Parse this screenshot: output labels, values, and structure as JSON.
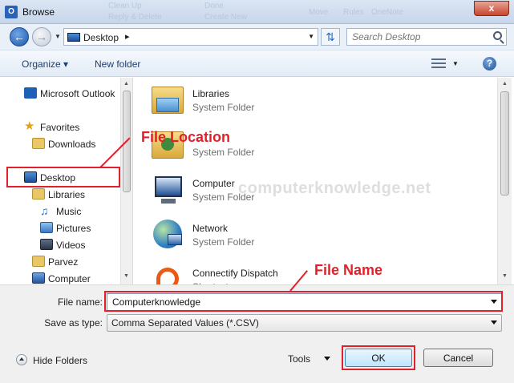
{
  "window": {
    "title": "Browse",
    "close_label": "x",
    "app_icon_label": "O",
    "background_ribbon": [
      "Clean Up",
      "Reply & Delete",
      "Done",
      "Create New",
      "Move",
      "Rules",
      "OneNote"
    ]
  },
  "nav": {
    "address": "Desktop",
    "address_separator": "▸",
    "search_placeholder": "Search Desktop"
  },
  "toolbar": {
    "organize_label": "Organize ▾",
    "new_folder_label": "New folder",
    "help_label": "?"
  },
  "sidebar": {
    "items": [
      {
        "label": "Microsoft Outlook",
        "icon": "outlook-icon"
      },
      {
        "label": "Favorites",
        "icon": "star-icon"
      },
      {
        "label": "Downloads",
        "icon": "downloads-folder-icon"
      },
      {
        "label": "Desktop",
        "icon": "desktop-icon"
      },
      {
        "label": "Libraries",
        "icon": "libraries-icon"
      },
      {
        "label": "Music",
        "icon": "music-icon"
      },
      {
        "label": "Pictures",
        "icon": "pictures-icon"
      },
      {
        "label": "Videos",
        "icon": "videos-icon"
      },
      {
        "label": "Parvez",
        "icon": "user-folder-icon"
      },
      {
        "label": "Computer",
        "icon": "computer-icon"
      }
    ]
  },
  "content": {
    "items": [
      {
        "name": "Libraries",
        "type": "System Folder",
        "icon": "libraries-icon"
      },
      {
        "name": "",
        "type": "System Folder",
        "icon": "user-folder-icon"
      },
      {
        "name": "Computer",
        "type": "System Folder",
        "icon": "computer-icon"
      },
      {
        "name": "Network",
        "type": "System Folder",
        "icon": "network-icon"
      },
      {
        "name": "Connectify Dispatch",
        "type": "Shortcut",
        "icon": "connectify-icon"
      }
    ],
    "watermark": "computerknowledge.net"
  },
  "form": {
    "file_name_label": "File name:",
    "file_name_value": "Computerknowledge",
    "save_type_label": "Save as type:",
    "save_type_value": "Comma Separated Values (*.CSV)",
    "hide_folders_label": "Hide Folders",
    "tools_label": "Tools",
    "ok_label": "OK",
    "cancel_label": "Cancel"
  },
  "annotations": {
    "file_location": "File Location",
    "file_name": "File Name",
    "color": "#e0202a"
  }
}
